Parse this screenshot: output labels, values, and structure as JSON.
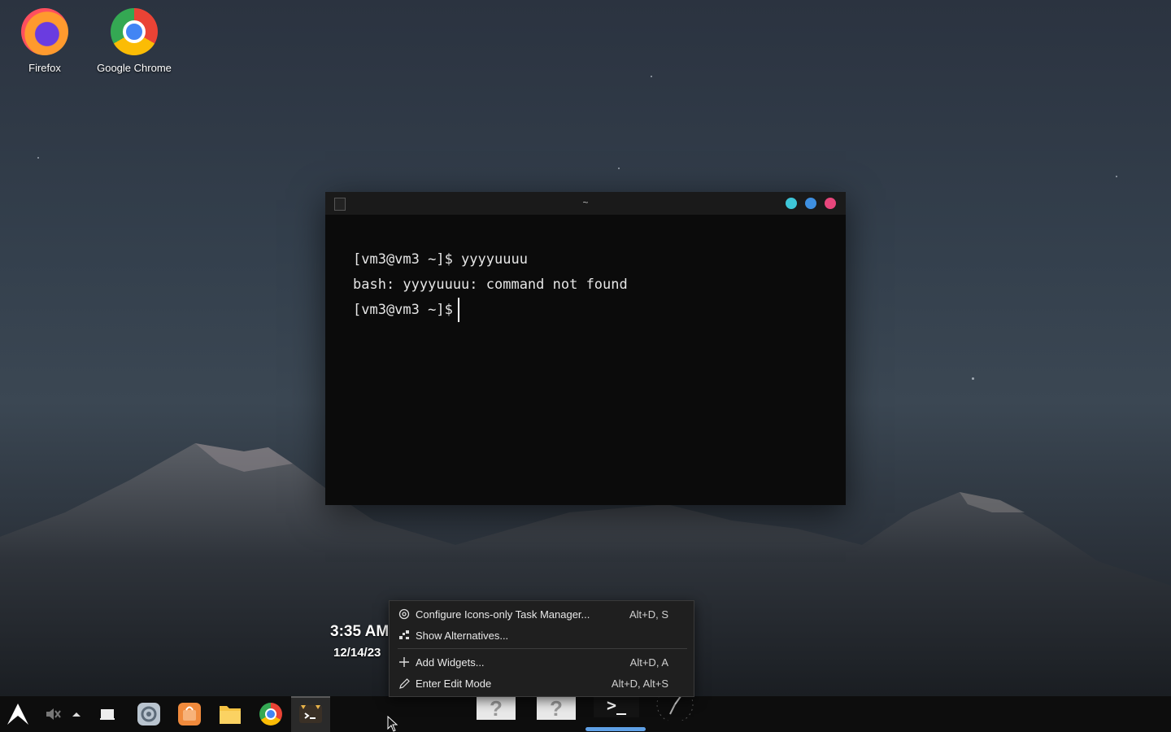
{
  "desktop": {
    "icons": [
      {
        "label": "Firefox"
      },
      {
        "label": "Google Chrome"
      }
    ]
  },
  "terminal": {
    "title": "~",
    "lines": [
      "[vm3@vm3 ~]$ yyyyuuuu",
      "bash: yyyyuuuu: command not found",
      "[vm3@vm3 ~]$"
    ],
    "buttons": {
      "minimize_color": "#3ec6d8",
      "maximize_color": "#3e8fe0",
      "close_color": "#e8467c"
    }
  },
  "clock": {
    "time": "3:35 AM",
    "date": "12/14/23"
  },
  "context_menu": {
    "items": [
      {
        "label": "Configure Icons-only Task Manager...",
        "shortcut": "Alt+D, S",
        "icon": "gear-icon"
      },
      {
        "label": "Show Alternatives...",
        "shortcut": "",
        "icon": "alternatives-icon"
      },
      {
        "label": "Add Widgets...",
        "shortcut": "Alt+D, A",
        "icon": "plus-icon"
      },
      {
        "label": "Enter Edit Mode",
        "shortcut": "Alt+D, Alt+S",
        "icon": "pencil-icon"
      }
    ]
  },
  "dock": {
    "placeholder_glyph": "?",
    "terminal_glyph": ">_"
  }
}
